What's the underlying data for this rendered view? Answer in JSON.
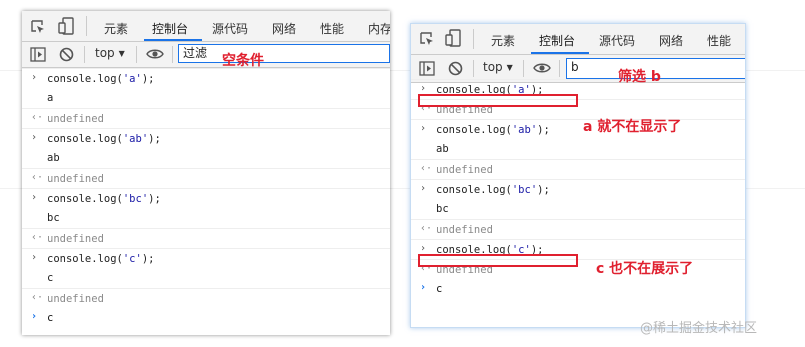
{
  "left_panel": {
    "tabs": [
      "元素",
      "控制台",
      "源代码",
      "网络",
      "性能",
      "内存"
    ],
    "active_tab": "控制台",
    "context": "top",
    "filter_value": "过滤",
    "annotation": "空条件",
    "lines": [
      {
        "kind": "in",
        "text": "console.log('a');"
      },
      {
        "kind": "out",
        "text": "a"
      },
      {
        "kind": "ret",
        "text": "undefined"
      },
      {
        "kind": "in",
        "text": "console.log('ab');"
      },
      {
        "kind": "out",
        "text": "ab"
      },
      {
        "kind": "ret",
        "text": "undefined"
      },
      {
        "kind": "in",
        "text": "console.log('bc');"
      },
      {
        "kind": "out",
        "text": "bc"
      },
      {
        "kind": "ret",
        "text": "undefined"
      },
      {
        "kind": "in",
        "text": "console.log('c');"
      },
      {
        "kind": "out",
        "text": "c"
      },
      {
        "kind": "ret",
        "text": "undefined"
      },
      {
        "kind": "prompt",
        "text": "c"
      }
    ]
  },
  "right_panel": {
    "tabs": [
      "元素",
      "控制台",
      "源代码",
      "网络",
      "性能"
    ],
    "active_tab": "控制台",
    "context": "top",
    "filter_value": "b",
    "annotation_filter": "筛选 b",
    "annotation_a": "a 就不在显示了",
    "annotation_c": "c 也不在展示了",
    "lines": [
      {
        "kind": "in",
        "text": "console.log('a');"
      },
      {
        "kind": "ret",
        "text": "undefined"
      },
      {
        "kind": "in",
        "text": "console.log('ab');"
      },
      {
        "kind": "out",
        "text": "ab"
      },
      {
        "kind": "ret",
        "text": "undefined"
      },
      {
        "kind": "in",
        "text": "console.log('bc');"
      },
      {
        "kind": "out",
        "text": "bc"
      },
      {
        "kind": "ret",
        "text": "undefined"
      },
      {
        "kind": "in",
        "text": "console.log('c');"
      },
      {
        "kind": "ret",
        "text": "undefined"
      },
      {
        "kind": "prompt",
        "text": "c"
      }
    ]
  },
  "watermark": "@稀土掘金技术社区",
  "colors": {
    "annotation": "#e0202f",
    "accent": "#1a73e8",
    "string": "#1a1aa6"
  }
}
